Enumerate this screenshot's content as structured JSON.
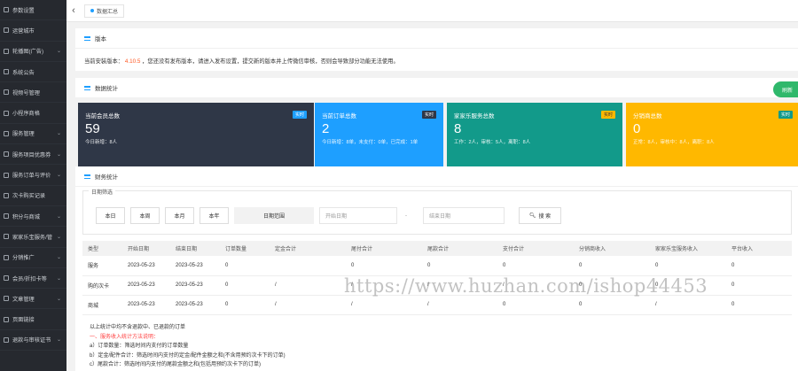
{
  "sidebar": {
    "items": [
      {
        "label": "参数设置",
        "chevron": false
      },
      {
        "label": "运营城市",
        "chevron": false
      },
      {
        "label": "轮播图(广告)",
        "chevron": true
      },
      {
        "label": "系统公告",
        "chevron": false
      },
      {
        "label": "视频号管理",
        "chevron": false
      },
      {
        "label": "小程序商格",
        "chevron": false
      },
      {
        "label": "服务管理",
        "chevron": true
      },
      {
        "label": "服务项目优惠券",
        "chevron": true
      },
      {
        "label": "服务订单与评价",
        "chevron": true
      },
      {
        "label": "次卡购买记录",
        "chevron": false
      },
      {
        "label": "积分与商城",
        "chevron": true
      },
      {
        "label": "家家乐宝服务/管",
        "chevron": true
      },
      {
        "label": "分销推广",
        "chevron": true
      },
      {
        "label": "会员/折扣卡等",
        "chevron": true
      },
      {
        "label": "文章管理",
        "chevron": true
      },
      {
        "label": "页面链接",
        "chevron": false
      },
      {
        "label": "退款与审核证书",
        "chevron": true
      }
    ]
  },
  "topbar": {
    "back": "‹",
    "tab_label": "数据汇总"
  },
  "version": {
    "title": "版本",
    "prefix": "当前安装版本：",
    "version": "4.10.5",
    "suffix": "，您还没有发布版本，请进入发布设置，提交新的版本并上传微信审核，否则会导致部分功能无法使用。"
  },
  "stats": {
    "title": "数据统计",
    "refresh": "刷新",
    "cards": [
      {
        "title": "当前会员总数",
        "value": "59",
        "detail": "今日新增：8人",
        "badge": "实时",
        "color": "#2f3747",
        "badge_bg": "#1e9fff",
        "badge_color": "#fff"
      },
      {
        "title": "当前订单总数",
        "value": "2",
        "detail": "今日新增：8单，未支付：0单，已完成：1单",
        "badge": "实时",
        "color": "#1e9fff",
        "badge_bg": "#2f3747",
        "badge_color": "#fff"
      },
      {
        "title": "家家乐服务总数",
        "value": "8",
        "detail": "工作：2人，审核：5人，离职：8人",
        "badge": "实时",
        "color": "#129a8a",
        "badge_bg": "#ffb800",
        "badge_color": "#333"
      },
      {
        "title": "分销商总数",
        "value": "0",
        "detail": "正常：8人，审核中：8人，离职：8人",
        "badge": "实时",
        "color": "#ffb800",
        "badge_bg": "#129a8a",
        "badge_color": "#fff"
      }
    ]
  },
  "finance": {
    "title": "财务统计",
    "filter_title": "日期筛选",
    "buttons": {
      "today": "本日",
      "week": "本周",
      "month": "本月",
      "year": "本年"
    },
    "range_label": "日期范围",
    "start_placeholder": "开始日期",
    "sep": "-",
    "end_placeholder": "结束日期",
    "search": "搜 索",
    "columns": [
      "类型",
      "开始日期",
      "结束日期",
      "订单数量",
      "定金合计",
      "尾付合计",
      "尾款合计",
      "支付合计",
      "分销商收入",
      "家家乐宝服务收入",
      "平台收入"
    ],
    "rows": [
      [
        "服务",
        "2023-05-23",
        "2023-05-23",
        "0",
        "",
        "0",
        "0",
        "0",
        "0",
        "0",
        "0"
      ],
      [
        "购的次卡",
        "2023-05-23",
        "2023-05-23",
        "0",
        "/",
        "/",
        "/",
        "/",
        "0",
        "0",
        "0"
      ],
      [
        "商城",
        "2023-05-23",
        "2023-05-23",
        "0",
        "/",
        "/",
        "/",
        "0",
        "0",
        "/",
        "0"
      ]
    ]
  },
  "notes": {
    "line1": "以上统计中均不含退款中、已退款的订单",
    "line2": "一、服务收入统计方法说明：",
    "line3": "a）订单数量：筛选时间内支付的订单数量",
    "line4": "b）定金/配件合计：筛选时间内支付的定金/配件金额之和(不含用预约次卡下的订单)",
    "line5": "c）尾款合计：筛选时间内支付的尾款金额之和(包括用预约次卡下的订单)"
  },
  "watermark": "https://www.huzhan.com/ishop44453"
}
